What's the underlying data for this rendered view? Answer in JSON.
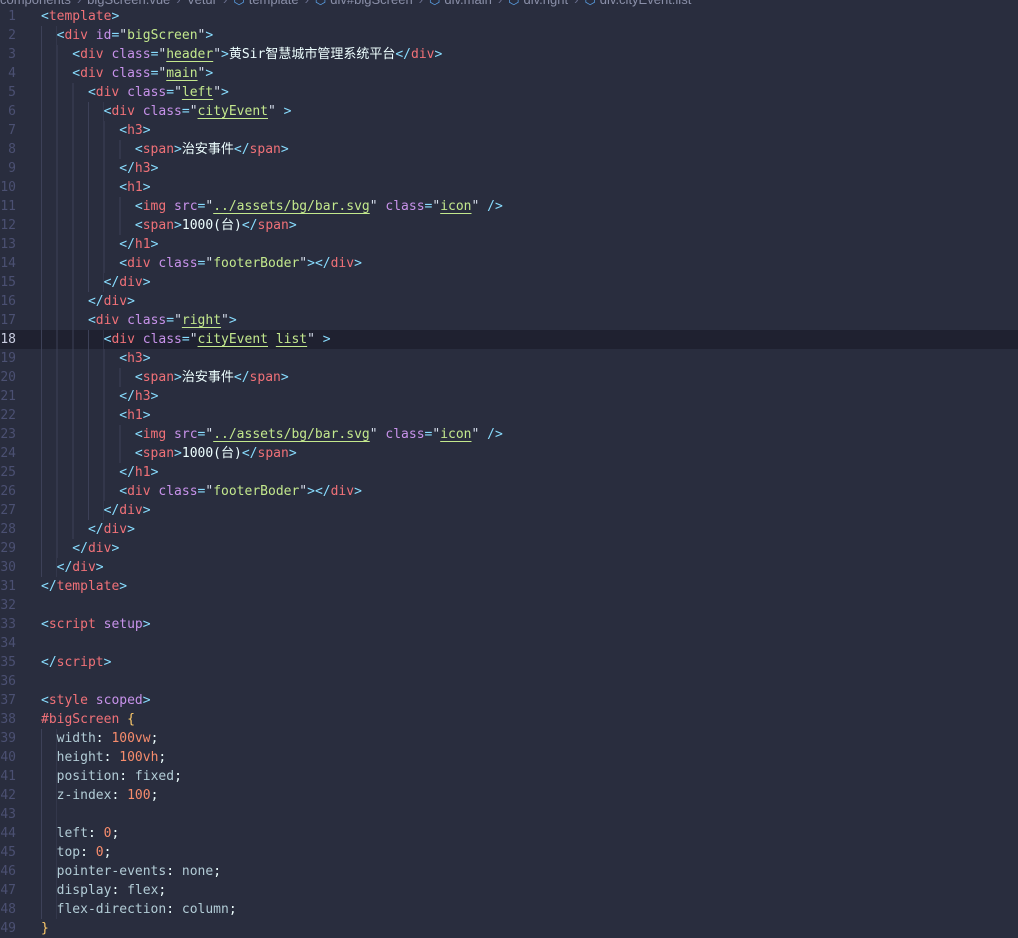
{
  "breadcrumb": [
    "components",
    "bigScreen.vue",
    "Vetur",
    "template",
    "div#bigScreen",
    "div.main",
    "div.right",
    "div.cityEvent.list"
  ],
  "active_line": 18,
  "code": {
    "lines": [
      {
        "indent": 0,
        "tokens": [
          [
            "p",
            "<"
          ],
          [
            "t",
            "template"
          ],
          [
            "p",
            ">"
          ]
        ]
      },
      {
        "indent": 2,
        "tokens": [
          [
            "p",
            "<"
          ],
          [
            "t",
            "div"
          ],
          [
            "x",
            " "
          ],
          [
            "a",
            "id"
          ],
          [
            "p",
            "="
          ],
          [
            "q",
            "\""
          ],
          [
            "s",
            "bigScreen"
          ],
          [
            "q",
            "\""
          ],
          [
            "p",
            ">"
          ]
        ]
      },
      {
        "indent": 4,
        "tokens": [
          [
            "p",
            "<"
          ],
          [
            "t",
            "div"
          ],
          [
            "x",
            " "
          ],
          [
            "a",
            "class"
          ],
          [
            "p",
            "="
          ],
          [
            "q",
            "\""
          ],
          [
            "su",
            "header"
          ],
          [
            "q",
            "\""
          ],
          [
            "p",
            ">"
          ],
          [
            "x",
            "黄Sir智慧城市管理系统平台"
          ],
          [
            "p",
            "</"
          ],
          [
            "t",
            "div"
          ],
          [
            "p",
            ">"
          ]
        ]
      },
      {
        "indent": 4,
        "tokens": [
          [
            "p",
            "<"
          ],
          [
            "t",
            "div"
          ],
          [
            "x",
            " "
          ],
          [
            "a",
            "class"
          ],
          [
            "p",
            "="
          ],
          [
            "q",
            "\""
          ],
          [
            "su",
            "main"
          ],
          [
            "q",
            "\""
          ],
          [
            "p",
            ">"
          ]
        ]
      },
      {
        "indent": 6,
        "tokens": [
          [
            "p",
            "<"
          ],
          [
            "t",
            "div"
          ],
          [
            "x",
            " "
          ],
          [
            "a",
            "class"
          ],
          [
            "p",
            "="
          ],
          [
            "q",
            "\""
          ],
          [
            "su",
            "left"
          ],
          [
            "q",
            "\""
          ],
          [
            "p",
            ">"
          ]
        ]
      },
      {
        "indent": 8,
        "tokens": [
          [
            "p",
            "<"
          ],
          [
            "t",
            "div"
          ],
          [
            "x",
            " "
          ],
          [
            "a",
            "class"
          ],
          [
            "p",
            "="
          ],
          [
            "q",
            "\""
          ],
          [
            "su",
            "cityEvent"
          ],
          [
            "q",
            "\""
          ],
          [
            "x",
            " "
          ],
          [
            "p",
            ">"
          ]
        ]
      },
      {
        "indent": 10,
        "tokens": [
          [
            "p",
            "<"
          ],
          [
            "t",
            "h3"
          ],
          [
            "p",
            ">"
          ]
        ]
      },
      {
        "indent": 12,
        "tokens": [
          [
            "p",
            "<"
          ],
          [
            "t",
            "span"
          ],
          [
            "p",
            ">"
          ],
          [
            "x",
            "治安事件"
          ],
          [
            "p",
            "</"
          ],
          [
            "t",
            "span"
          ],
          [
            "p",
            ">"
          ]
        ]
      },
      {
        "indent": 10,
        "tokens": [
          [
            "p",
            "</"
          ],
          [
            "t",
            "h3"
          ],
          [
            "p",
            ">"
          ]
        ]
      },
      {
        "indent": 10,
        "tokens": [
          [
            "p",
            "<"
          ],
          [
            "t",
            "h1"
          ],
          [
            "p",
            ">"
          ]
        ]
      },
      {
        "indent": 12,
        "tokens": [
          [
            "p",
            "<"
          ],
          [
            "t",
            "img"
          ],
          [
            "x",
            " "
          ],
          [
            "a",
            "src"
          ],
          [
            "p",
            "="
          ],
          [
            "q",
            "\""
          ],
          [
            "su",
            "../assets/bg/bar.svg"
          ],
          [
            "q",
            "\""
          ],
          [
            "x",
            " "
          ],
          [
            "a",
            "class"
          ],
          [
            "p",
            "="
          ],
          [
            "q",
            "\""
          ],
          [
            "su",
            "icon"
          ],
          [
            "q",
            "\""
          ],
          [
            "x",
            " "
          ],
          [
            "p",
            "/>"
          ]
        ]
      },
      {
        "indent": 12,
        "tokens": [
          [
            "p",
            "<"
          ],
          [
            "t",
            "span"
          ],
          [
            "p",
            ">"
          ],
          [
            "x",
            "1000(台)"
          ],
          [
            "p",
            "</"
          ],
          [
            "t",
            "span"
          ],
          [
            "p",
            ">"
          ]
        ]
      },
      {
        "indent": 10,
        "tokens": [
          [
            "p",
            "</"
          ],
          [
            "t",
            "h1"
          ],
          [
            "p",
            ">"
          ]
        ]
      },
      {
        "indent": 10,
        "tokens": [
          [
            "p",
            "<"
          ],
          [
            "t",
            "div"
          ],
          [
            "x",
            " "
          ],
          [
            "a",
            "class"
          ],
          [
            "p",
            "="
          ],
          [
            "q",
            "\""
          ],
          [
            "s",
            "footerBoder"
          ],
          [
            "q",
            "\""
          ],
          [
            "p",
            ">"
          ],
          [
            "p",
            "</"
          ],
          [
            "t",
            "div"
          ],
          [
            "p",
            ">"
          ]
        ]
      },
      {
        "indent": 8,
        "tokens": [
          [
            "p",
            "</"
          ],
          [
            "t",
            "div"
          ],
          [
            "p",
            ">"
          ]
        ]
      },
      {
        "indent": 6,
        "tokens": [
          [
            "p",
            "</"
          ],
          [
            "t",
            "div"
          ],
          [
            "p",
            ">"
          ]
        ]
      },
      {
        "indent": 6,
        "tokens": [
          [
            "p",
            "<"
          ],
          [
            "t",
            "div"
          ],
          [
            "x",
            " "
          ],
          [
            "a",
            "class"
          ],
          [
            "p",
            "="
          ],
          [
            "q",
            "\""
          ],
          [
            "su",
            "right"
          ],
          [
            "q",
            "\""
          ],
          [
            "p",
            ">"
          ]
        ]
      },
      {
        "indent": 8,
        "tokens": [
          [
            "p",
            "<"
          ],
          [
            "t",
            "div"
          ],
          [
            "x",
            " "
          ],
          [
            "a",
            "class"
          ],
          [
            "p",
            "="
          ],
          [
            "q",
            "\""
          ],
          [
            "su",
            "cityEvent"
          ],
          [
            "x",
            " "
          ],
          [
            "su",
            "list"
          ],
          [
            "q",
            "\""
          ],
          [
            "x",
            " "
          ],
          [
            "p",
            ">"
          ]
        ]
      },
      {
        "indent": 10,
        "tokens": [
          [
            "p",
            "<"
          ],
          [
            "t",
            "h3"
          ],
          [
            "p",
            ">"
          ]
        ]
      },
      {
        "indent": 12,
        "tokens": [
          [
            "p",
            "<"
          ],
          [
            "t",
            "span"
          ],
          [
            "p",
            ">"
          ],
          [
            "x",
            "治安事件"
          ],
          [
            "p",
            "</"
          ],
          [
            "t",
            "span"
          ],
          [
            "p",
            ">"
          ]
        ]
      },
      {
        "indent": 10,
        "tokens": [
          [
            "p",
            "</"
          ],
          [
            "t",
            "h3"
          ],
          [
            "p",
            ">"
          ]
        ]
      },
      {
        "indent": 10,
        "tokens": [
          [
            "p",
            "<"
          ],
          [
            "t",
            "h1"
          ],
          [
            "p",
            ">"
          ]
        ]
      },
      {
        "indent": 12,
        "tokens": [
          [
            "p",
            "<"
          ],
          [
            "t",
            "img"
          ],
          [
            "x",
            " "
          ],
          [
            "a",
            "src"
          ],
          [
            "p",
            "="
          ],
          [
            "q",
            "\""
          ],
          [
            "su",
            "../assets/bg/bar.svg"
          ],
          [
            "q",
            "\""
          ],
          [
            "x",
            " "
          ],
          [
            "a",
            "class"
          ],
          [
            "p",
            "="
          ],
          [
            "q",
            "\""
          ],
          [
            "su",
            "icon"
          ],
          [
            "q",
            "\""
          ],
          [
            "x",
            " "
          ],
          [
            "p",
            "/>"
          ]
        ]
      },
      {
        "indent": 12,
        "tokens": [
          [
            "p",
            "<"
          ],
          [
            "t",
            "span"
          ],
          [
            "p",
            ">"
          ],
          [
            "x",
            "1000(台)"
          ],
          [
            "p",
            "</"
          ],
          [
            "t",
            "span"
          ],
          [
            "p",
            ">"
          ]
        ]
      },
      {
        "indent": 10,
        "tokens": [
          [
            "p",
            "</"
          ],
          [
            "t",
            "h1"
          ],
          [
            "p",
            ">"
          ]
        ]
      },
      {
        "indent": 10,
        "tokens": [
          [
            "p",
            "<"
          ],
          [
            "t",
            "div"
          ],
          [
            "x",
            " "
          ],
          [
            "a",
            "class"
          ],
          [
            "p",
            "="
          ],
          [
            "q",
            "\""
          ],
          [
            "s",
            "footerBoder"
          ],
          [
            "q",
            "\""
          ],
          [
            "p",
            ">"
          ],
          [
            "p",
            "</"
          ],
          [
            "t",
            "div"
          ],
          [
            "p",
            ">"
          ]
        ]
      },
      {
        "indent": 8,
        "tokens": [
          [
            "p",
            "</"
          ],
          [
            "t",
            "div"
          ],
          [
            "p",
            ">"
          ]
        ]
      },
      {
        "indent": 6,
        "tokens": [
          [
            "p",
            "</"
          ],
          [
            "t",
            "div"
          ],
          [
            "p",
            ">"
          ]
        ]
      },
      {
        "indent": 4,
        "tokens": [
          [
            "p",
            "</"
          ],
          [
            "t",
            "div"
          ],
          [
            "p",
            ">"
          ]
        ]
      },
      {
        "indent": 2,
        "tokens": [
          [
            "p",
            "</"
          ],
          [
            "t",
            "div"
          ],
          [
            "p",
            ">"
          ]
        ]
      },
      {
        "indent": 0,
        "tokens": [
          [
            "p",
            "</"
          ],
          [
            "t",
            "template"
          ],
          [
            "p",
            ">"
          ]
        ]
      },
      {
        "indent": 0,
        "tokens": []
      },
      {
        "indent": 0,
        "tokens": [
          [
            "p",
            "<"
          ],
          [
            "t",
            "script"
          ],
          [
            "x",
            " "
          ],
          [
            "k",
            "setup"
          ],
          [
            "p",
            ">"
          ]
        ]
      },
      {
        "indent": 0,
        "tokens": []
      },
      {
        "indent": 0,
        "tokens": [
          [
            "p",
            "</"
          ],
          [
            "t",
            "script"
          ],
          [
            "p",
            ">"
          ]
        ]
      },
      {
        "indent": 0,
        "tokens": []
      },
      {
        "indent": 0,
        "tokens": [
          [
            "p",
            "<"
          ],
          [
            "t",
            "style"
          ],
          [
            "x",
            " "
          ],
          [
            "k",
            "scoped"
          ],
          [
            "p",
            ">"
          ]
        ]
      },
      {
        "indent": 0,
        "tokens": [
          [
            "sel",
            "#bigScreen"
          ],
          [
            "x",
            " "
          ],
          [
            "b",
            "{"
          ]
        ]
      },
      {
        "indent": 2,
        "tokens": [
          [
            "pr",
            "width"
          ],
          [
            "x",
            ": "
          ],
          [
            "n",
            "100vw"
          ],
          [
            "x",
            ";"
          ]
        ]
      },
      {
        "indent": 2,
        "tokens": [
          [
            "pr",
            "height"
          ],
          [
            "x",
            ": "
          ],
          [
            "n",
            "100vh"
          ],
          [
            "x",
            ";"
          ]
        ]
      },
      {
        "indent": 2,
        "tokens": [
          [
            "pr",
            "position"
          ],
          [
            "x",
            ": "
          ],
          [
            "pr",
            "fixed"
          ],
          [
            "x",
            ";"
          ]
        ]
      },
      {
        "indent": 2,
        "tokens": [
          [
            "pr",
            "z-index"
          ],
          [
            "x",
            ": "
          ],
          [
            "n",
            "100"
          ],
          [
            "x",
            ";"
          ]
        ]
      },
      {
        "indent": 2,
        "tokens": []
      },
      {
        "indent": 2,
        "tokens": [
          [
            "pr",
            "left"
          ],
          [
            "x",
            ": "
          ],
          [
            "n",
            "0"
          ],
          [
            "x",
            ";"
          ]
        ]
      },
      {
        "indent": 2,
        "tokens": [
          [
            "pr",
            "top"
          ],
          [
            "x",
            ": "
          ],
          [
            "n",
            "0"
          ],
          [
            "x",
            ";"
          ]
        ]
      },
      {
        "indent": 2,
        "tokens": [
          [
            "pr",
            "pointer-events"
          ],
          [
            "x",
            ": "
          ],
          [
            "pr",
            "none"
          ],
          [
            "x",
            ";"
          ]
        ]
      },
      {
        "indent": 2,
        "tokens": [
          [
            "pr",
            "display"
          ],
          [
            "x",
            ": "
          ],
          [
            "pr",
            "flex"
          ],
          [
            "x",
            ";"
          ]
        ]
      },
      {
        "indent": 2,
        "tokens": [
          [
            "pr",
            "flex-direction"
          ],
          [
            "x",
            ": "
          ],
          [
            "pr",
            "column"
          ],
          [
            "x",
            ";"
          ]
        ]
      },
      {
        "indent": 0,
        "tokens": [
          [
            "b",
            "}"
          ]
        ]
      }
    ]
  }
}
